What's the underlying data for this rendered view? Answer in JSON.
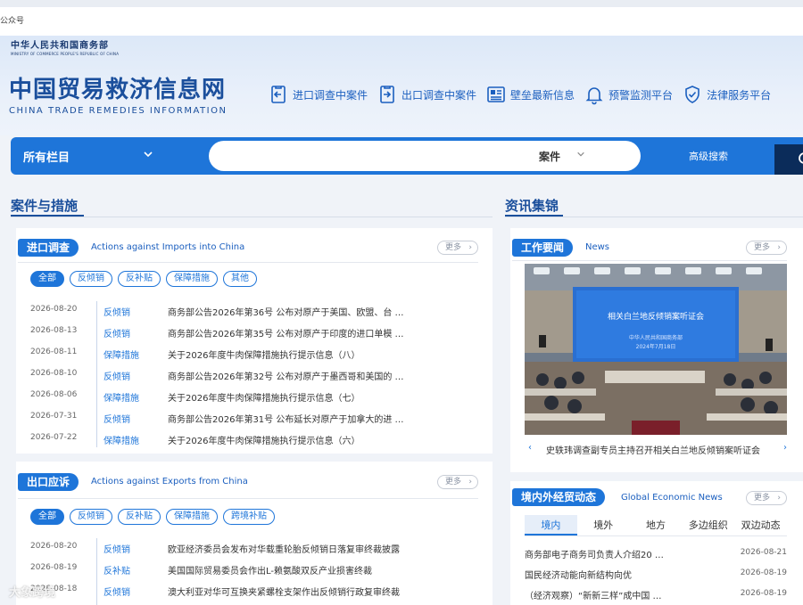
{
  "top_strip": {
    "label": "公众号"
  },
  "header": {
    "ministry_cn": "中华人民共和国商务部",
    "ministry_en": "MINISTRY OF COMMERCE PEOPLE'S REPUBLIC OF CHINA",
    "site_cn": "中国贸易救济信息网",
    "site_en": "CHINA TRADE REMEDIES INFORMATION",
    "quick_links": [
      {
        "label": "进口调查中案件",
        "icon": "import-doc-icon"
      },
      {
        "label": "出口调查中案件",
        "icon": "export-doc-icon"
      },
      {
        "label": "壁垒最新信息",
        "icon": "newspaper-icon"
      },
      {
        "label": "预警监测平台",
        "icon": "bell-icon"
      },
      {
        "label": "法律服务平台",
        "icon": "shield-check-icon"
      }
    ]
  },
  "search": {
    "category_label": "所有栏目",
    "query": "",
    "type_label": "案件",
    "advanced_label": "高级搜索"
  },
  "sections": {
    "left_title": "案件与措施",
    "right_title": "资讯集锦"
  },
  "import_card": {
    "tag": "进口调查",
    "subtitle": "Actions against Imports into China",
    "more": "更多",
    "filters": [
      "全部",
      "反倾销",
      "反补贴",
      "保障措施",
      "其他"
    ],
    "rows": [
      {
        "date": "2026-08-20",
        "type": "反倾销",
        "title": "商务部公告2026年第36号 公布对原产于美国、欧盟、台 …"
      },
      {
        "date": "2026-08-13",
        "type": "反倾销",
        "title": "商务部公告2026年第35号 公布对原产于印度的进口单模 …"
      },
      {
        "date": "2026-08-11",
        "type": "保障措施",
        "title": "关于2026年度牛肉保障措施执行提示信息（八）"
      },
      {
        "date": "2026-08-10",
        "type": "反倾销",
        "title": "商务部公告2026年第32号 公布对原产于墨西哥和美国的 …"
      },
      {
        "date": "2026-08-06",
        "type": "保障措施",
        "title": "关于2026年度牛肉保障措施执行提示信息（七）"
      },
      {
        "date": "2026-07-31",
        "type": "反倾销",
        "title": "商务部公告2026年第31号 公布延长对原产于加拿大的进 …"
      },
      {
        "date": "2026-07-22",
        "type": "保障措施",
        "title": "关于2026年度牛肉保障措施执行提示信息（六）"
      }
    ]
  },
  "export_card": {
    "tag": "出口应诉",
    "subtitle": "Actions against Exports from China",
    "more": "更多",
    "filters": [
      "全部",
      "反倾销",
      "反补贴",
      "保障措施",
      "跨境补贴"
    ],
    "rows": [
      {
        "date": "2026-08-20",
        "type": "反倾销",
        "title": "欧亚经济委员会发布对华载重轮胎反倾销日落复审终裁披露"
      },
      {
        "date": "2026-08-19",
        "type": "反补贴",
        "title": "美国国际贸易委员会作出L-赖氨酸双反产业损害终裁"
      },
      {
        "date": "2026-08-18",
        "type": "反倾销",
        "title": "澳大利亚对华可互换夹紧螺栓支架作出反倾销行政复审终裁"
      }
    ]
  },
  "news_card": {
    "tag": "工作要闻",
    "subtitle": "News",
    "more": "更多",
    "photo_screen_title": "相关白兰地反倾销案听证会",
    "photo_screen_sub": "中华人民共和国商务部",
    "photo_screen_date": "2024年7月18日",
    "caption": "史轶玮调查副专员主持召开相关白兰地反倾销案听证会"
  },
  "trade_card": {
    "tag": "境内外经贸动态",
    "subtitle": "Global Economic News",
    "more": "更多",
    "tabs": [
      "境内",
      "境外",
      "地方",
      "多边组织",
      "双边动态"
    ],
    "rows": [
      {
        "title": "商务部电子商务司负责人介绍20 …",
        "date": "2026-08-21"
      },
      {
        "title": "国民经济动能向新结构向优",
        "date": "2026-08-19"
      },
      {
        "title": "（经济观察）“新新三样”成中国 …",
        "date": "2026-08-19"
      }
    ]
  },
  "watermark": "大象跨境",
  "colors": {
    "primary": "#1e75d9",
    "brand": "#1b4f9c",
    "dark_button": "#0b2c5a"
  }
}
